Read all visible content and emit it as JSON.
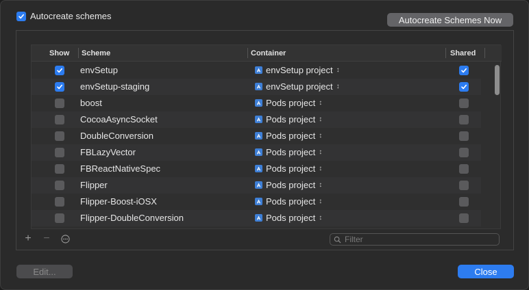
{
  "autocreate": {
    "label": "Autocreate schemes",
    "checked": true
  },
  "autocreate_now_label": "Autocreate Schemes Now",
  "table": {
    "headers": {
      "show": "Show",
      "scheme": "Scheme",
      "container": "Container",
      "shared": "Shared"
    },
    "rows": [
      {
        "show": true,
        "scheme": "envSetup",
        "container": "envSetup project",
        "shared": true
      },
      {
        "show": true,
        "scheme": "envSetup-staging",
        "container": "envSetup project",
        "shared": true
      },
      {
        "show": false,
        "scheme": "boost",
        "container": "Pods project",
        "shared": false
      },
      {
        "show": false,
        "scheme": "CocoaAsyncSocket",
        "container": "Pods project",
        "shared": false
      },
      {
        "show": false,
        "scheme": "DoubleConversion",
        "container": "Pods project",
        "shared": false
      },
      {
        "show": false,
        "scheme": "FBLazyVector",
        "container": "Pods project",
        "shared": false
      },
      {
        "show": false,
        "scheme": "FBReactNativeSpec",
        "container": "Pods project",
        "shared": false
      },
      {
        "show": false,
        "scheme": "Flipper",
        "container": "Pods project",
        "shared": false
      },
      {
        "show": false,
        "scheme": "Flipper-Boost-iOSX",
        "container": "Pods project",
        "shared": false
      },
      {
        "show": false,
        "scheme": "Flipper-DoubleConversion",
        "container": "Pods project",
        "shared": false
      }
    ]
  },
  "tools": {
    "add": "+",
    "remove": "−",
    "more": "⋯"
  },
  "filter": {
    "placeholder": "Filter",
    "value": ""
  },
  "buttons": {
    "edit": "Edit...",
    "close": "Close"
  },
  "colors": {
    "accent": "#2d7cf0",
    "background": "#2a2a2a"
  }
}
